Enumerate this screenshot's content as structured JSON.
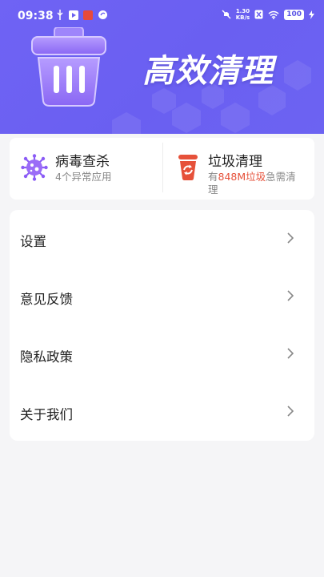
{
  "status_bar": {
    "time": "09:38",
    "speed_top": "1.30",
    "speed_bottom": "KB/s",
    "battery": "100",
    "icons": [
      "usb-icon",
      "play-icon",
      "app-badge-icon",
      "sync-icon",
      "mute-icon",
      "sim-off-icon",
      "wifi-icon",
      "charging-icon"
    ]
  },
  "header": {
    "title": "高效清理",
    "gradient_colors": [
      "#6f63f4",
      "#6a5ff1"
    ],
    "icon": "trash-bin-icon"
  },
  "feature_cards": [
    {
      "title": "病毒查杀",
      "subtitle": "4个异常应用",
      "icon": "virus-icon",
      "color": "#8b5cf6"
    },
    {
      "title": "垃圾清理",
      "subtitle_prefix": "有",
      "subtitle_highlight": "848M垃圾",
      "subtitle_suffix": "急需清理",
      "icon": "trash-cup-icon",
      "color": "#e6513a"
    }
  ],
  "menu": [
    {
      "label": "设置"
    },
    {
      "label": "意见反馈"
    },
    {
      "label": "隐私政策"
    },
    {
      "label": "关于我们"
    }
  ]
}
